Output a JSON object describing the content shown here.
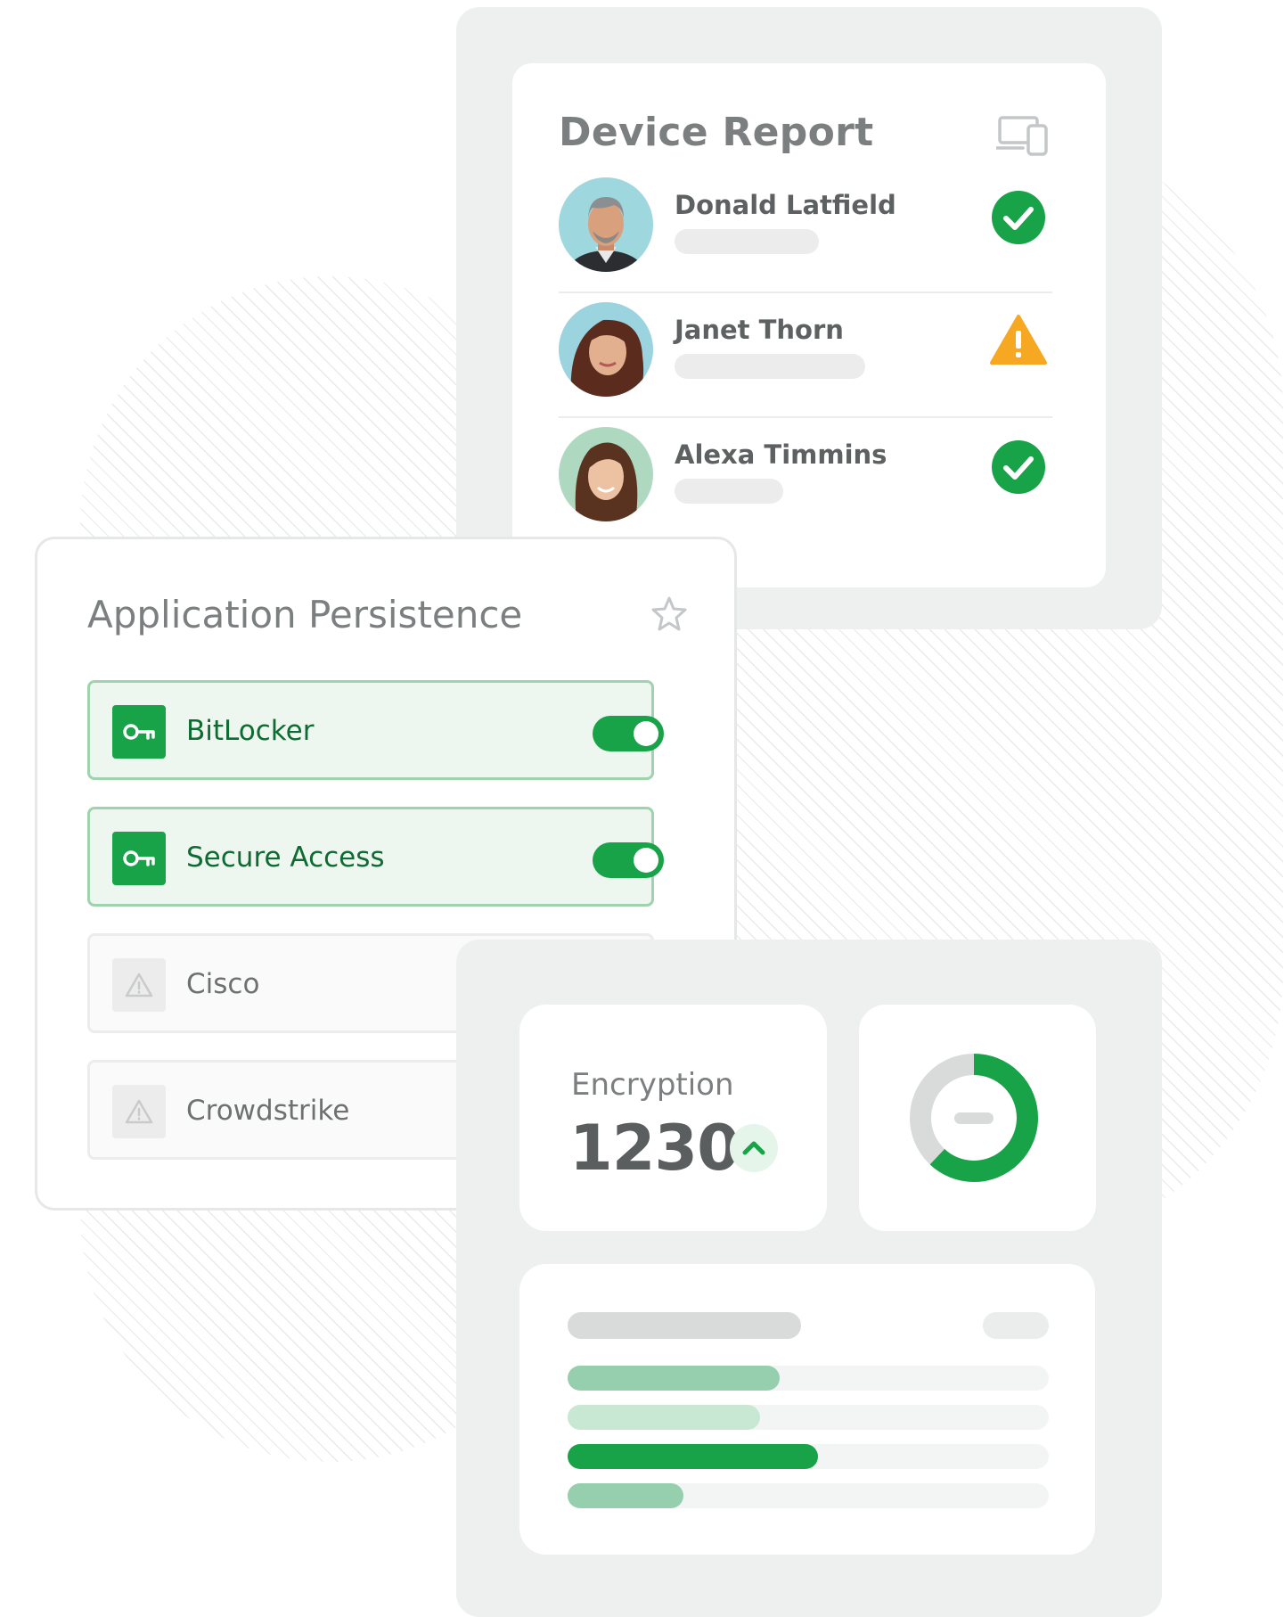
{
  "device_report": {
    "title": "Device Report",
    "header_icon": "devices-icon",
    "people": [
      {
        "name": "Donald Latfield",
        "status": "ok",
        "status_icon": "check-circle-icon"
      },
      {
        "name": "Janet Thorn",
        "status": "warning",
        "status_icon": "warning-triangle-icon"
      },
      {
        "name": "Alexa Timmins",
        "status": "ok",
        "status_icon": "check-circle-icon"
      }
    ]
  },
  "app_persistence": {
    "title": "Application Persistence",
    "header_icon": "star-icon",
    "items": [
      {
        "label": "BitLocker",
        "icon": "key-icon",
        "enabled": true
      },
      {
        "label": "Secure Access",
        "icon": "key-icon",
        "enabled": true
      },
      {
        "label": "Cisco",
        "icon": "warning-icon",
        "enabled": false
      },
      {
        "label": "Crowdstrike",
        "icon": "warning-icon",
        "enabled": false
      }
    ]
  },
  "stats": {
    "encryption_label": "Encryption",
    "encryption_value": "1230",
    "trend_icon": "chevron-up-icon",
    "donut_fraction": 0.62,
    "bars": [
      0.44,
      0.4,
      0.52,
      0.24
    ]
  },
  "colors": {
    "brand_green": "#18a349",
    "warning": "#f7a823",
    "light_green": "#95cfad",
    "pale_green": "#c9e8d3"
  }
}
